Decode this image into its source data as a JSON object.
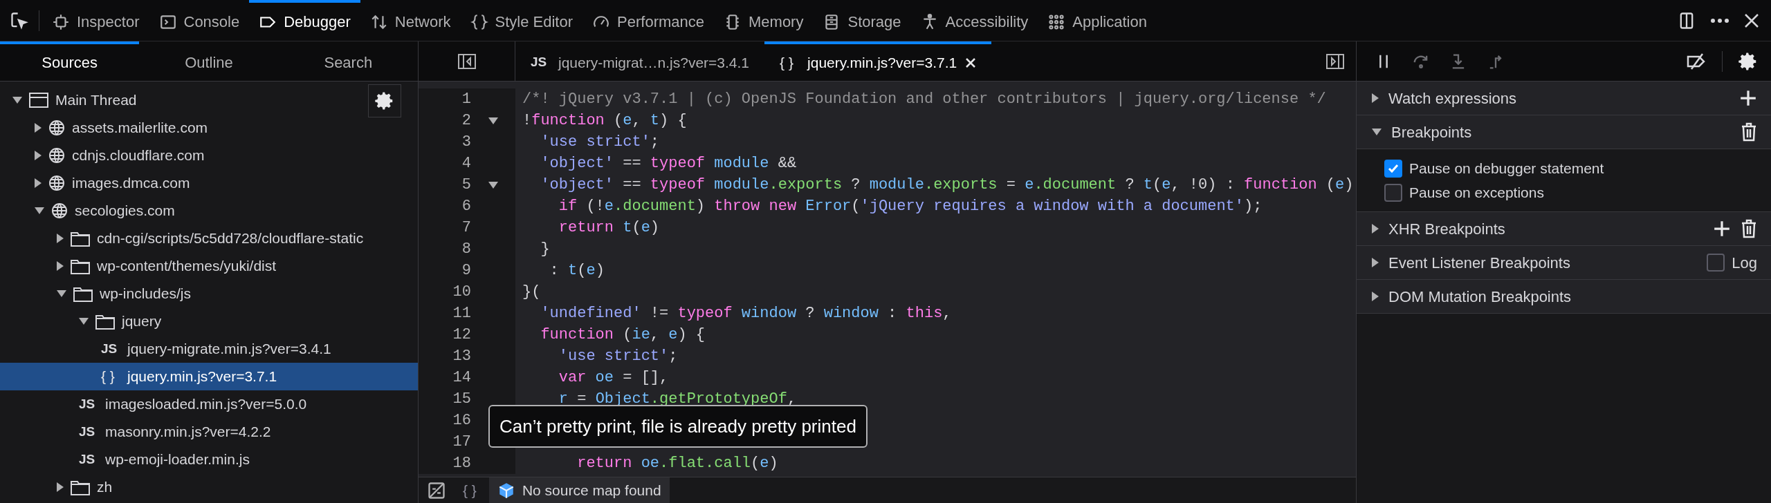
{
  "toolbar": {
    "tabs": [
      {
        "label": "Inspector",
        "selected": false
      },
      {
        "label": "Console",
        "selected": false
      },
      {
        "label": "Debugger",
        "selected": true
      },
      {
        "label": "Network",
        "selected": false
      },
      {
        "label": "Style Editor",
        "selected": false
      },
      {
        "label": "Performance",
        "selected": false
      },
      {
        "label": "Memory",
        "selected": false
      },
      {
        "label": "Storage",
        "selected": false
      },
      {
        "label": "Accessibility",
        "selected": false
      },
      {
        "label": "Application",
        "selected": false
      }
    ]
  },
  "sidebar": {
    "tabs": [
      {
        "label": "Sources",
        "selected": true
      },
      {
        "label": "Outline",
        "selected": false
      },
      {
        "label": "Search",
        "selected": false
      }
    ],
    "tree": [
      {
        "kind": "thread",
        "label": "Main Thread",
        "expanded": true,
        "selected": false,
        "children": [
          {
            "kind": "domain",
            "label": "assets.mailerlite.com",
            "expanded": false,
            "selected": false
          },
          {
            "kind": "domain",
            "label": "cdnjs.cloudflare.com",
            "expanded": false,
            "selected": false
          },
          {
            "kind": "domain",
            "label": "images.dmca.com",
            "expanded": false,
            "selected": false
          },
          {
            "kind": "domain",
            "label": "secologies.com",
            "expanded": true,
            "selected": false,
            "children": [
              {
                "kind": "folder",
                "label": "cdn-cgi/scripts/5c5dd728/cloudflare-static",
                "expanded": false,
                "selected": false
              },
              {
                "kind": "folder",
                "label": "wp-content/themes/yuki/dist",
                "expanded": false,
                "selected": false
              },
              {
                "kind": "folder",
                "label": "wp-includes/js",
                "expanded": true,
                "selected": false,
                "children": [
                  {
                    "kind": "folder",
                    "label": "jquery",
                    "expanded": true,
                    "selected": false,
                    "children": [
                      {
                        "kind": "js",
                        "icon": "JS",
                        "label": "jquery-migrate.min.js?ver=3.4.1",
                        "selected": false
                      },
                      {
                        "kind": "formatted",
                        "icon": "{ }",
                        "label": "jquery.min.js?ver=3.7.1",
                        "selected": true
                      }
                    ]
                  },
                  {
                    "kind": "js",
                    "icon": "JS",
                    "label": "imagesloaded.min.js?ver=5.0.0",
                    "selected": false
                  },
                  {
                    "kind": "js",
                    "icon": "JS",
                    "label": "masonry.min.js?ver=4.2.2",
                    "selected": false
                  },
                  {
                    "kind": "js",
                    "icon": "JS",
                    "label": "wp-emoji-loader.min.js",
                    "selected": false
                  }
                ]
              },
              {
                "kind": "folder",
                "label": "zh",
                "expanded": false,
                "selected": false
              }
            ]
          }
        ]
      }
    ]
  },
  "editor": {
    "tabs": [
      {
        "kind": "js",
        "icon": "JS",
        "label": "jquery-migrat…n.js?ver=3.4.1",
        "selected": false
      },
      {
        "kind": "formatted",
        "icon": "{ }",
        "label": "jquery.min.js?ver=3.7.1",
        "selected": true
      }
    ],
    "lines": [
      {
        "number": "1",
        "foldable": false,
        "tokens": [
          {
            "kind": "comment",
            "text": "/*! jQuery v3.7.1 | (c) OpenJS Foundation and other contributors | jquery.org/license */"
          }
        ]
      },
      {
        "number": "2",
        "foldable": true,
        "tokens": [
          {
            "kind": "punct",
            "text": "!"
          },
          {
            "kind": "keyword",
            "text": "function"
          },
          {
            "kind": "punct",
            "text": " ("
          },
          {
            "kind": "name",
            "text": "e"
          },
          {
            "kind": "punct",
            "text": ", "
          },
          {
            "kind": "name",
            "text": "t"
          },
          {
            "kind": "punct",
            "text": ") {"
          }
        ]
      },
      {
        "number": "3",
        "foldable": false,
        "tokens": [
          {
            "kind": "string",
            "text": "  'use strict'"
          },
          {
            "kind": "punct",
            "text": ";"
          }
        ]
      },
      {
        "number": "4",
        "foldable": false,
        "tokens": [
          {
            "kind": "string",
            "text": "  'object'"
          },
          {
            "kind": "punct",
            "text": " == "
          },
          {
            "kind": "keyword",
            "text": "typeof"
          },
          {
            "kind": "name",
            "text": " module"
          },
          {
            "kind": "punct",
            "text": " &&"
          }
        ]
      },
      {
        "number": "5",
        "foldable": true,
        "tokens": [
          {
            "kind": "string",
            "text": "  'object'"
          },
          {
            "kind": "punct",
            "text": " == "
          },
          {
            "kind": "keyword",
            "text": "typeof"
          },
          {
            "kind": "name",
            "text": " module"
          },
          {
            "kind": "property",
            "text": ".exports"
          },
          {
            "kind": "punct",
            "text": " ? "
          },
          {
            "kind": "name",
            "text": "module"
          },
          {
            "kind": "property",
            "text": ".exports"
          },
          {
            "kind": "punct",
            "text": " = "
          },
          {
            "kind": "name",
            "text": "e"
          },
          {
            "kind": "property",
            "text": ".document"
          },
          {
            "kind": "punct",
            "text": " ? "
          },
          {
            "kind": "name",
            "text": "t"
          },
          {
            "kind": "punct",
            "text": "("
          },
          {
            "kind": "name",
            "text": "e"
          },
          {
            "kind": "punct",
            "text": ", !0) : "
          },
          {
            "kind": "keyword",
            "text": "function"
          },
          {
            "kind": "punct",
            "text": " ("
          },
          {
            "kind": "name",
            "text": "e"
          },
          {
            "kind": "punct",
            "text": ")"
          }
        ]
      },
      {
        "number": "6",
        "foldable": false,
        "tokens": [
          {
            "kind": "keyword",
            "text": "    if"
          },
          {
            "kind": "punct",
            "text": " (!"
          },
          {
            "kind": "name",
            "text": "e"
          },
          {
            "kind": "property",
            "text": ".document"
          },
          {
            "kind": "punct",
            "text": ") "
          },
          {
            "kind": "keyword",
            "text": "throw new"
          },
          {
            "kind": "name",
            "text": " Error"
          },
          {
            "kind": "punct",
            "text": "("
          },
          {
            "kind": "string",
            "text": "'jQuery requires a window with a document'"
          },
          {
            "kind": "punct",
            "text": ");"
          }
        ]
      },
      {
        "number": "7",
        "foldable": false,
        "tokens": [
          {
            "kind": "keyword",
            "text": "    return"
          },
          {
            "kind": "name",
            "text": " t"
          },
          {
            "kind": "punct",
            "text": "("
          },
          {
            "kind": "name",
            "text": "e"
          },
          {
            "kind": "punct",
            "text": ")"
          }
        ]
      },
      {
        "number": "8",
        "foldable": false,
        "tokens": [
          {
            "kind": "punct",
            "text": "  }"
          }
        ]
      },
      {
        "number": "9",
        "foldable": false,
        "tokens": [
          {
            "kind": "punct",
            "text": "   : "
          },
          {
            "kind": "name",
            "text": "t"
          },
          {
            "kind": "punct",
            "text": "("
          },
          {
            "kind": "name",
            "text": "e"
          },
          {
            "kind": "punct",
            "text": ")"
          }
        ]
      },
      {
        "number": "10",
        "foldable": false,
        "tokens": [
          {
            "kind": "punct",
            "text": "}("
          }
        ]
      },
      {
        "number": "11",
        "foldable": false,
        "tokens": [
          {
            "kind": "string",
            "text": "  'undefined'"
          },
          {
            "kind": "punct",
            "text": " != "
          },
          {
            "kind": "keyword",
            "text": "typeof"
          },
          {
            "kind": "name",
            "text": " window"
          },
          {
            "kind": "punct",
            "text": " ? "
          },
          {
            "kind": "name",
            "text": "window"
          },
          {
            "kind": "punct",
            "text": " : "
          },
          {
            "kind": "keyword",
            "text": "this"
          },
          {
            "kind": "punct",
            "text": ","
          }
        ]
      },
      {
        "number": "12",
        "foldable": false,
        "tokens": [
          {
            "kind": "keyword",
            "text": "  function"
          },
          {
            "kind": "punct",
            "text": " ("
          },
          {
            "kind": "name",
            "text": "ie"
          },
          {
            "kind": "punct",
            "text": ", "
          },
          {
            "kind": "name",
            "text": "e"
          },
          {
            "kind": "punct",
            "text": ") {"
          }
        ]
      },
      {
        "number": "13",
        "foldable": false,
        "tokens": [
          {
            "kind": "string",
            "text": "    'use strict'"
          },
          {
            "kind": "punct",
            "text": ";"
          }
        ]
      },
      {
        "number": "14",
        "foldable": false,
        "tokens": [
          {
            "kind": "keyword",
            "text": "    var"
          },
          {
            "kind": "name",
            "text": " oe"
          },
          {
            "kind": "punct",
            "text": " = [],"
          }
        ]
      },
      {
        "number": "15",
        "foldable": false,
        "tokens": [
          {
            "kind": "name",
            "text": "    r"
          },
          {
            "kind": "punct",
            "text": " = "
          },
          {
            "kind": "name",
            "text": "Object"
          },
          {
            "kind": "property",
            "text": ".getPrototypeOf"
          },
          {
            "kind": "punct",
            "text": ","
          }
        ]
      },
      {
        "number": "16"
      },
      {
        "number": "17"
      },
      {
        "number": "18",
        "foldable": false,
        "tokens": [
          {
            "kind": "keyword",
            "text": "      return"
          },
          {
            "kind": "name",
            "text": " oe"
          },
          {
            "kind": "property",
            "text": ".flat.call"
          },
          {
            "kind": "punct",
            "text": "("
          },
          {
            "kind": "name",
            "text": "e"
          },
          {
            "kind": "punct",
            "text": ")"
          }
        ]
      }
    ],
    "tooltip": "Can’t pretty print, file is already pretty printed",
    "footer": {
      "pretty_print": "{ }",
      "source_map": "No source map found"
    }
  },
  "debugger_panel": {
    "controls": [
      {
        "kind": "pause",
        "disabled": false
      },
      {
        "kind": "step-over",
        "disabled": true
      },
      {
        "kind": "step-in",
        "disabled": true
      },
      {
        "kind": "step-out",
        "disabled": true
      }
    ],
    "sections": [
      {
        "title": "Watch expressions",
        "expanded": false,
        "actions": [
          {
            "kind": "add"
          }
        ]
      },
      {
        "title": "Breakpoints",
        "expanded": true,
        "actions": [
          {
            "kind": "delete"
          }
        ],
        "options": [
          {
            "label": "Pause on debugger statement",
            "checked": true
          },
          {
            "label": "Pause on exceptions",
            "checked": false
          }
        ]
      },
      {
        "title": "XHR Breakpoints",
        "expanded": false,
        "actions": [
          {
            "kind": "add"
          },
          {
            "kind": "delete"
          }
        ]
      },
      {
        "title": "Event Listener Breakpoints",
        "expanded": false,
        "log": {
          "label": "Log",
          "checked": false
        }
      },
      {
        "title": "DOM Mutation Breakpoints",
        "expanded": false
      }
    ]
  }
}
